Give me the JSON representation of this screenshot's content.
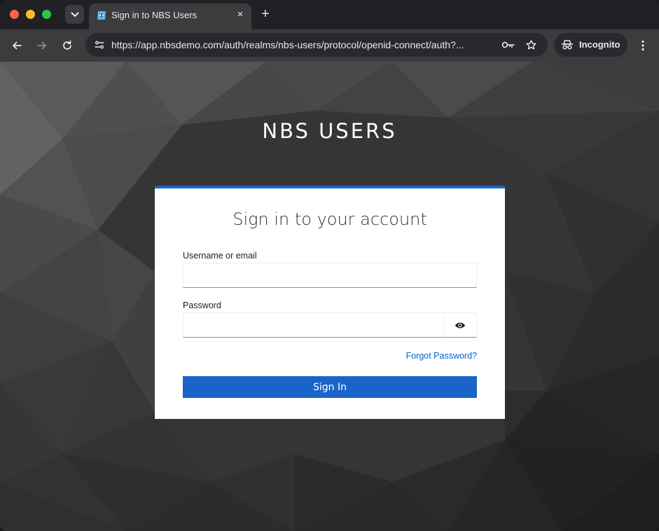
{
  "browser": {
    "tab_title": "Sign in to NBS Users",
    "new_tab_symbol": "+",
    "close_symbol": "×",
    "url": "https://app.nbsdemo.com/auth/realms/nbs-users/protocol/openid-connect/auth?...",
    "incognito_label": "Incognito"
  },
  "page": {
    "brand": "NBS USERS",
    "card_title": "Sign in to your account",
    "username_label": "Username or email",
    "username_value": "",
    "password_label": "Password",
    "password_value": "",
    "forgot_password": "Forgot Password?",
    "signin_label": "Sign In"
  },
  "colors": {
    "accent": "#1864c9",
    "link": "#0066cc",
    "browser_dark": "#202124",
    "toolbar": "#3c3c3f"
  },
  "icons": [
    "chevron-down-icon",
    "site-favicon-icon",
    "close-icon",
    "plus-icon",
    "back-arrow-icon",
    "forward-arrow-icon",
    "reload-icon",
    "site-info-icon",
    "key-icon",
    "star-icon",
    "incognito-icon",
    "more-vert-icon",
    "eye-icon"
  ]
}
